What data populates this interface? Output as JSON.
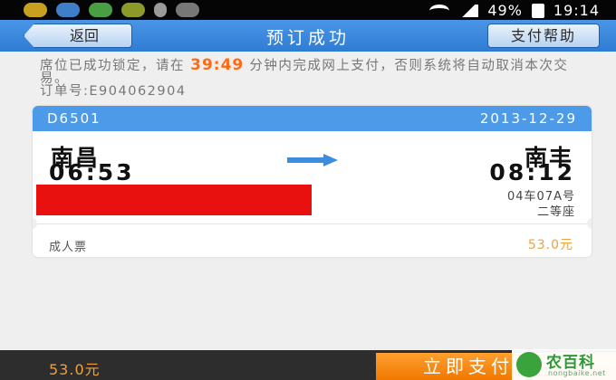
{
  "status_bar": {
    "battery": "49%",
    "time": "19:14",
    "icons": [
      "notification-icon",
      "gallery-icon",
      "app-icon",
      "usb-icon",
      "game-icon",
      "wifi-icon",
      "signal-icon",
      "battery-icon"
    ]
  },
  "nav": {
    "back_label": "返回",
    "title": "预订成功",
    "help_label": "支付帮助"
  },
  "notice": {
    "text_before": "席位已成功锁定，请在",
    "countdown": "39:49",
    "text_after": "分钟内完成网上支付，否则系统将自动取消本次交易。",
    "order_label": "订单号:",
    "order_number": "E904062904"
  },
  "ticket": {
    "train_number": "D6501",
    "date": "2013-12-29",
    "from_station": "南昌",
    "to_station": "南丰",
    "departure_time": "06:53",
    "arrival_time": "08:12",
    "seat_number": "04车07A号",
    "seat_class": "二等座",
    "ticket_type": "成人票",
    "price": "53.0元"
  },
  "bottom_bar": {
    "total": "53.0元",
    "pay_label": "立即支付"
  },
  "watermark": {
    "title": "农百科",
    "subtitle": "nongbaike.net"
  },
  "colors": {
    "nav_blue": "#3a86da",
    "card_header_blue": "#4d9be8",
    "countdown_orange": "#ff6a13",
    "price_orange": "#f0a040",
    "pay_orange": "#f58a10",
    "redaction_red": "#e8110f"
  }
}
